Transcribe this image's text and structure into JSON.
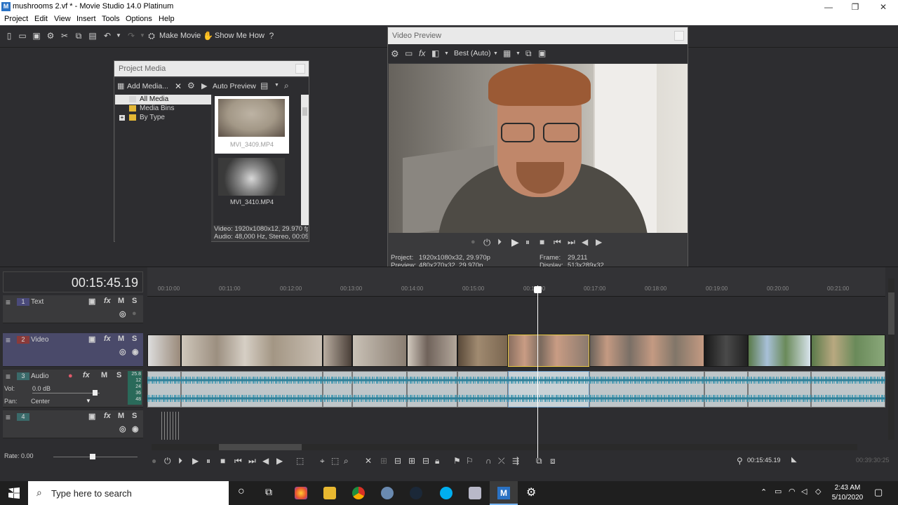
{
  "window": {
    "title": "mushrooms 2.vf * - Movie Studio 14.0 Platinum",
    "app_icon": "M"
  },
  "menu": [
    "Project",
    "Edit",
    "View",
    "Insert",
    "Tools",
    "Options",
    "Help"
  ],
  "toolbar": {
    "make_movie": "Make Movie",
    "show_me_how": "Show Me How"
  },
  "project_media": {
    "title": "Project Media",
    "add_media": "Add Media...",
    "auto_preview": "Auto Preview",
    "tree": [
      "All Media",
      "Media Bins",
      "By Type"
    ],
    "expander": "+",
    "files": [
      "MVI_3409.MP4",
      "MVI_3410.MP4"
    ],
    "info_line1": "Video: 1920x1080x12, 29.970 fps",
    "info_line2": "Audio: 48,000 Hz, Stereo, 00:05:"
  },
  "video_preview": {
    "title": "Video Preview",
    "quality": "Best (Auto)",
    "project_label": "Project:",
    "project_value": "1920x1080x32, 29.970p",
    "preview_label": "Preview:",
    "preview_value": "480x270x32, 29.970p",
    "frame_label": "Frame:",
    "frame_value": "29,211",
    "display_label": "Display:",
    "display_value": "513x289x32"
  },
  "timeline": {
    "timecode": "00:15:45.19",
    "ruler": [
      "00:10:00",
      "00:11:00",
      "00:12:00",
      "00:13:00",
      "00:14:00",
      "00:15:00",
      "00:16:00",
      "00:17:00",
      "00:18:00",
      "00:19:00",
      "00:20:00",
      "00:21:00"
    ],
    "tracks": [
      {
        "num": "1",
        "name": "Text",
        "type": "text"
      },
      {
        "num": "2",
        "name": "Video",
        "type": "video"
      },
      {
        "num": "3",
        "name": "Audio",
        "type": "audio"
      },
      {
        "num": "4",
        "name": "",
        "type": "empty"
      }
    ],
    "m_label": "M",
    "s_label": "S",
    "fx_label": "fx",
    "vol_label": "Vol:",
    "vol_value": "0.0 dB",
    "pan_label": "Pan:",
    "pan_value": "Center",
    "meter_labels": [
      "25.8",
      "12",
      "24",
      "36",
      "48"
    ],
    "rate": "Rate: 0.00",
    "cursor_time": "00:15:45.19",
    "dim_time": "00:39:30:25"
  },
  "taskbar": {
    "search_placeholder": "Type here to search",
    "time": "2:43 AM",
    "date": "5/10/2020",
    "pinned_app_label": "M"
  },
  "colors": {
    "accent": "#2a72c4",
    "clip_border": "#e8c840",
    "waveform": "#4a9bb4"
  }
}
